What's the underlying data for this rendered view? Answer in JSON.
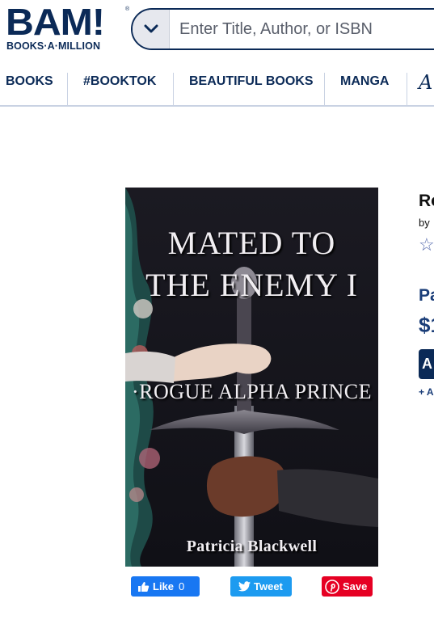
{
  "header": {
    "logo_main": "BAM!",
    "logo_sub": "BOOKS·A·MILLION",
    "logo_reg": "®",
    "search_placeholder": "Enter Title, Author, or ISBN"
  },
  "nav": {
    "items": [
      "BOOKS",
      "#BOOKTOK",
      "BEAUTIFUL BOOKS",
      "MANGA"
    ],
    "script_glyph": "A"
  },
  "book": {
    "cover_title_line1": "MATED TO",
    "cover_title_line2": "THE ENEMY I",
    "cover_subtitle": "·ROGUE ALPHA PRINCE",
    "cover_author": "Patricia Blackwell"
  },
  "product": {
    "title_visible": "Ro",
    "by_visible": "by",
    "star": "☆",
    "format_visible": "Pa",
    "price_visible": "$1",
    "add_visible": "A",
    "wishlist_visible": "+ A"
  },
  "social": {
    "like_label": "Like",
    "like_count": "0",
    "tweet_label": "Tweet",
    "save_label": "Save"
  },
  "colors": {
    "brand_navy": "#0b2a57",
    "facebook": "#1877f2",
    "twitter": "#1d9bf0",
    "pinterest": "#e60023"
  }
}
